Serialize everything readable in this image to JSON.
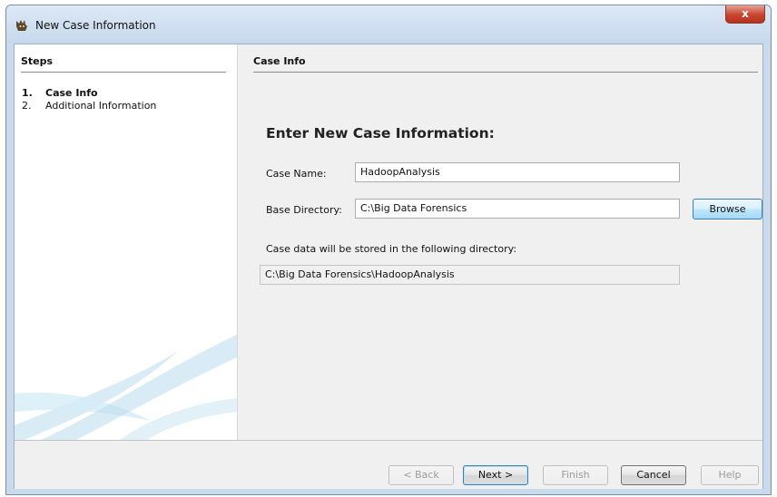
{
  "window": {
    "title": "New Case Information",
    "close_glyph": "x"
  },
  "steps": {
    "header": "Steps",
    "items": [
      {
        "number": "1.",
        "label": "Case Info",
        "active": true
      },
      {
        "number": "2.",
        "label": "Additional Information",
        "active": false
      }
    ]
  },
  "panel": {
    "header": "Case Info",
    "heading": "Enter New Case Information:",
    "case_name": {
      "label": "Case Name:",
      "value": "HadoopAnalysis"
    },
    "base_directory": {
      "label": "Base Directory:",
      "value": "C:\\Big Data Forensics"
    },
    "browse_label": "Browse",
    "info_text": "Case data will be stored in the following directory:",
    "storage_path": "C:\\Big Data Forensics\\HadoopAnalysis"
  },
  "buttons": {
    "back": "< Back",
    "next": "Next >",
    "finish": "Finish",
    "cancel": "Cancel",
    "help": "Help"
  },
  "colors": {
    "title_bar": "#c6d8ec",
    "close_button": "#c8442f",
    "focus_blue": "#3c7fb1"
  },
  "icons": {
    "app": "autopsy-dog-icon",
    "close": "close-icon",
    "decoration": "swoosh-decoration"
  }
}
